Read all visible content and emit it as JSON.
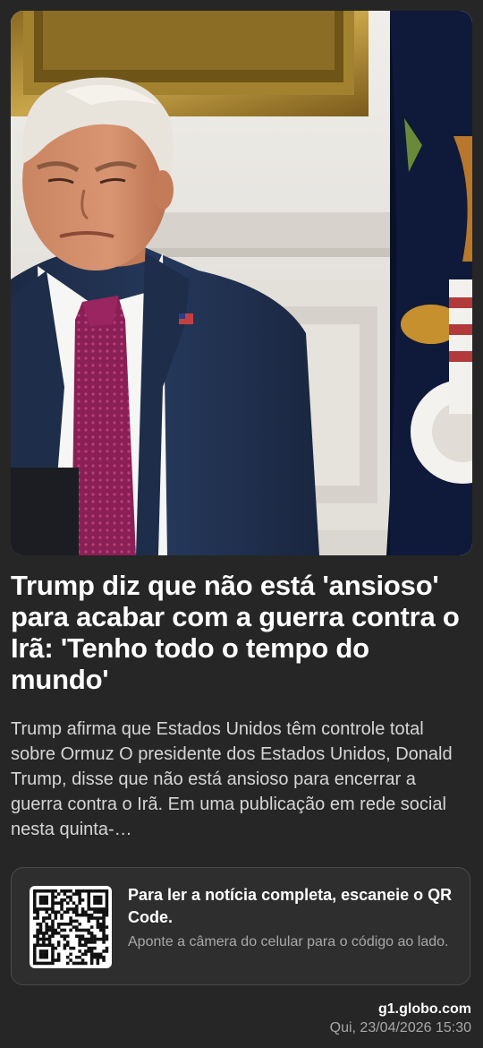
{
  "article": {
    "image_subject": "news-photo",
    "headline": "Trump diz que não está 'ansioso' para acabar com a guerra contra o Irã: 'Tenho todo o tempo do mundo'",
    "summary": "Trump afirma que Estados Unidos têm controle total sobre Ormuz O presidente dos Estados Unidos, Donald Trump, disse que não está ansioso para encerrar a guerra contra o Irã. Em uma publicação em rede social nesta quinta-…"
  },
  "qr_card": {
    "title": "Para ler a notícia completa, escaneie o QR Code.",
    "subtitle": "Aponte a câmera do celular para o código ao lado.",
    "icon": "qr-code-icon"
  },
  "footer": {
    "source": "g1.globo.com",
    "datetime": "Qui, 23/04/2026 15:30"
  },
  "colors": {
    "background": "#262626",
    "card": "#2e2e2e",
    "text_primary": "#ffffff",
    "text_secondary": "#a8a8a8"
  }
}
